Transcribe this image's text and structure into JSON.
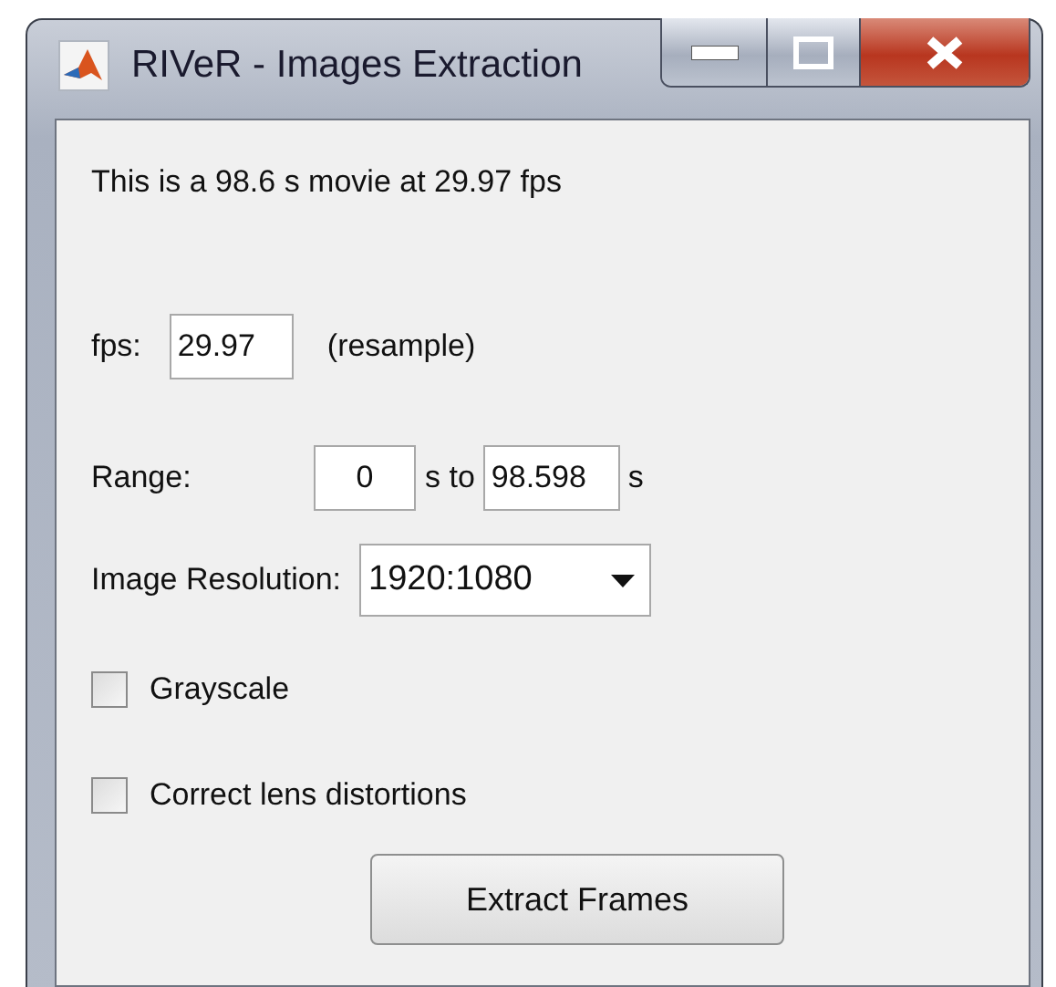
{
  "window": {
    "title": "RIVeR - Images Extraction"
  },
  "info": "This is a 98.6 s movie at 29.97 fps",
  "fps": {
    "label": "fps:",
    "value": "29.97",
    "note": "(resample)"
  },
  "range": {
    "label": "Range:",
    "start": "0",
    "middle": "s to",
    "end": "98.598",
    "unit": "s"
  },
  "resolution": {
    "label": "Image Resolution:",
    "value": "1920:1080"
  },
  "checkboxes": [
    {
      "label": "Grayscale",
      "checked": false
    },
    {
      "label": "Correct lens distortions",
      "checked": false
    }
  ],
  "button": "Extract Frames"
}
